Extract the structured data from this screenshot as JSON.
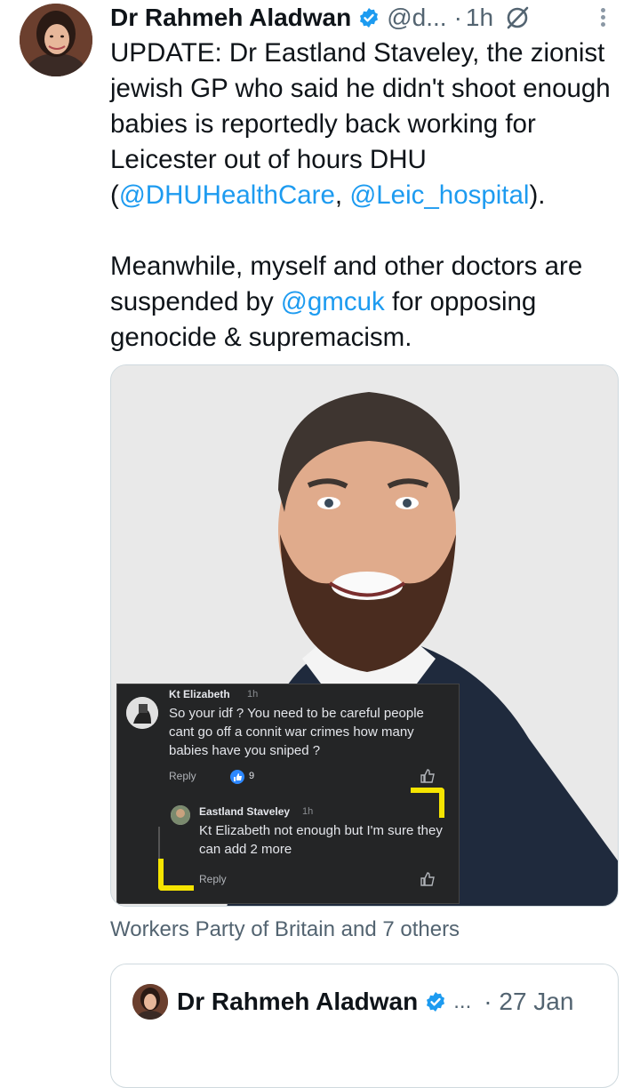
{
  "tweet": {
    "author_name": "Dr Rahmeh Aladwan",
    "handle": "@d...",
    "separator": "·",
    "time": "1h",
    "paragraph1": {
      "text": "UPDATE: Dr Eastland Staveley, the zionist jewish GP who said he didn't shoot enough babies is reportedly back working for Leicester out of hours DHU (",
      "mention1": "@DHUHealthCare",
      "between": ", ",
      "mention2": "@Leic_hospital",
      "end": ")."
    },
    "paragraph2": {
      "start": "Meanwhile, myself and other doctors are suspended by ",
      "mention": "@gmcuk",
      "end": " for opposing genocide & supremacism."
    },
    "social_context": "Workers Party of Britain and 7 others"
  },
  "screenshot_comments": {
    "comment1": {
      "author": "Kt Elizabeth",
      "time": "1h",
      "text": "So your idf ? You need to be careful people cant go off a connit war crimes how many babies have you sniped ?",
      "reply": "Reply",
      "likes": "9"
    },
    "comment2": {
      "author": "Eastland Staveley",
      "time": "1h",
      "text": "Kt Elizabeth not enough but I'm sure they can add 2 more",
      "reply": "Reply"
    }
  },
  "quoted_tweet": {
    "author_name": "Dr Rahmeh Aladwan",
    "ellipsis": "...",
    "date": "· 27 Jan"
  },
  "colors": {
    "accent": "#1d9bf0",
    "secondary_text": "#536471",
    "highlight": "#f5e400"
  },
  "icons": [
    "verified-badge-icon",
    "grok-icon",
    "more-options-icon",
    "like-icon",
    "thumbs-up-icon"
  ]
}
